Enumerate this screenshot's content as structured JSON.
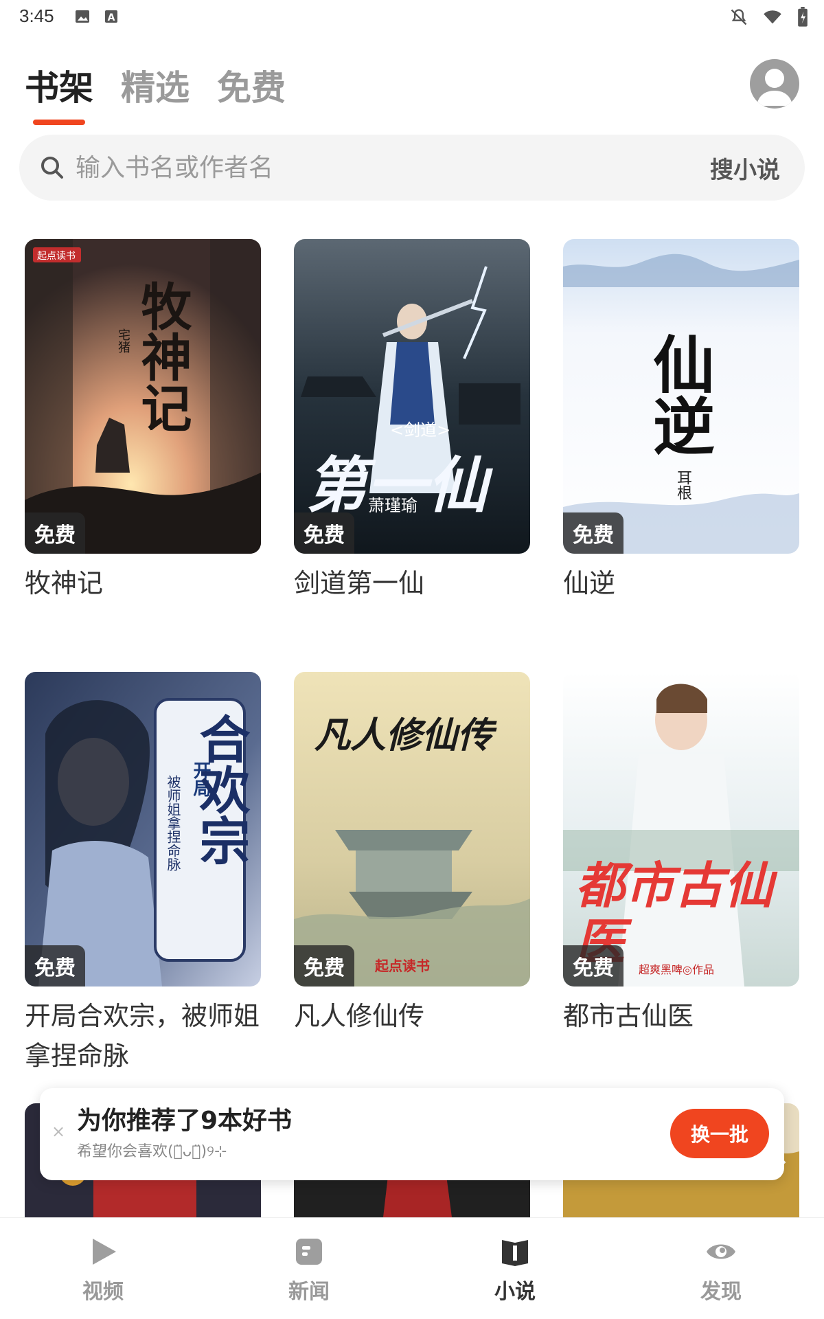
{
  "status_bar": {
    "time": "3:45"
  },
  "header": {
    "tabs": [
      {
        "label": "书架",
        "active": true
      },
      {
        "label": "精选",
        "active": false
      },
      {
        "label": "免费",
        "active": false
      }
    ]
  },
  "search": {
    "placeholder": "输入书名或作者名",
    "button": "搜小说"
  },
  "books": [
    {
      "title": "牧神记",
      "badge": "免费",
      "cover_text": "牧神记",
      "cover_brand": "起点读书",
      "cover_author": "宅猪"
    },
    {
      "title": "剑道第一仙",
      "badge": "免费",
      "cover_text": "第一仙",
      "cover_top": "<剑道>",
      "cover_author": "萧瑾瑜"
    },
    {
      "title": "仙逆",
      "badge": "免费",
      "cover_text": "仙逆",
      "cover_author": "耳根"
    },
    {
      "title": "开局合欢宗，被师姐拿捏命脉",
      "badge": "免费",
      "cover_text": "合欢宗",
      "cover_sub": "被师姐拿捏命脉",
      "cover_open": "开局"
    },
    {
      "title": "凡人修仙传",
      "badge": "免费",
      "cover_text": "凡人修仙传",
      "cover_brand": "起点读书"
    },
    {
      "title": "都市古仙医",
      "badge": "免费",
      "cover_text": "都市古仙医",
      "cover_author": "超爽黑啤◎作品"
    }
  ],
  "recommend": {
    "title": "为你推荐了9本好书",
    "subtitle": "希望你会喜欢(ด̈ᴗด̈)୨⊹",
    "button": "换一批",
    "close": "×"
  },
  "bottom_nav": [
    {
      "label": "视频",
      "icon": "play-icon",
      "active": false
    },
    {
      "label": "新闻",
      "icon": "news-icon",
      "active": false
    },
    {
      "label": "小说",
      "icon": "book-icon",
      "active": true
    },
    {
      "label": "发现",
      "icon": "eye-icon",
      "active": false
    }
  ],
  "colors": {
    "accent": "#f0451f",
    "text": "#222222",
    "muted": "#9a9a9a"
  }
}
